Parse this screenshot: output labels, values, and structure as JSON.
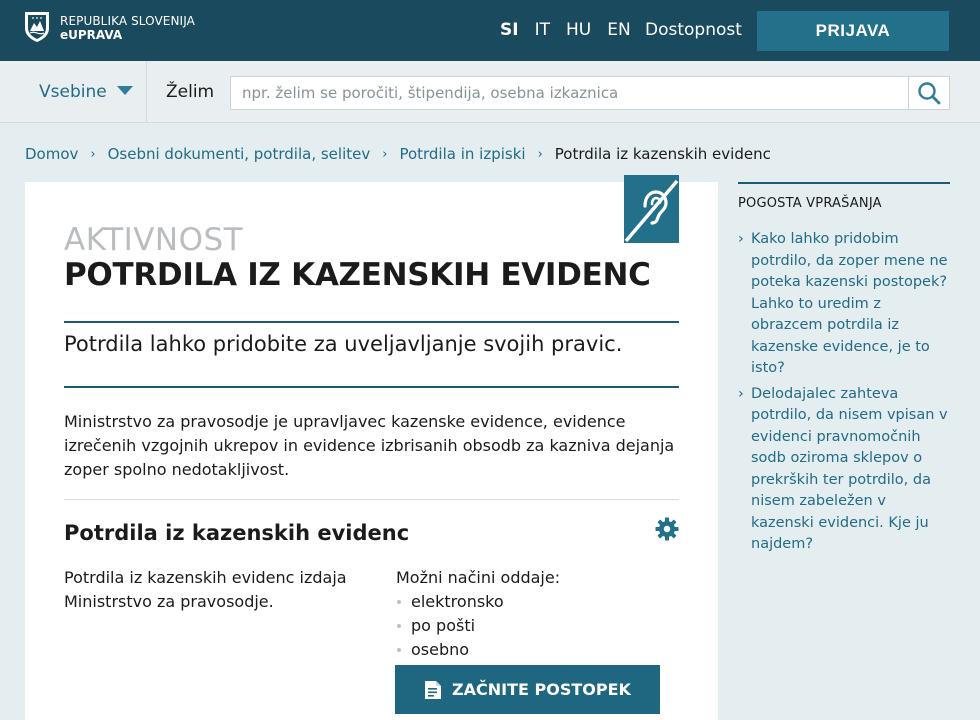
{
  "header": {
    "brand_line1": "REPUBLIKA SLOVENIJA",
    "brand_line2": "eUPRAVA",
    "languages": [
      {
        "code": "SI",
        "active": true
      },
      {
        "code": "IT",
        "active": false
      },
      {
        "code": "HU",
        "active": false
      },
      {
        "code": "EN",
        "active": false
      }
    ],
    "accessibility_link": "Dostopnost",
    "login_label": "PRIJAVA"
  },
  "search": {
    "menu_label": "Vsebine",
    "prefix_label": "Želim",
    "placeholder": "npr. želim se poročiti, štipendija, osebna izkaznica",
    "value": ""
  },
  "breadcrumb": {
    "items": [
      "Domov",
      "Osebni dokumenti, potrdila, selitev",
      "Potrdila in izpiski"
    ],
    "current": "Potrdila iz kazenskih evidenc",
    "separator": "›"
  },
  "main": {
    "eyebrow": "AKTIVNOST",
    "title": "POTRDILA IZ KAZENSKIH EVIDENC",
    "lead": "Potrdila lahko pridobite za uveljavljanje svojih pravic.",
    "description": "Ministrstvo za pravosodje je upravljavec kazenske evidence, evidence izrečenih vzgojnih ukrepov in evidence izbrisanih obsodb za kazniva dejanja zoper spolno nedotakljivost.",
    "section": {
      "title": "Potrdila iz kazenskih evidenc",
      "issuer": "Potrdila iz kazenskih evidenc izdaja Ministrstvo za pravosodje.",
      "methods_label": "Možni načini oddaje:",
      "methods": [
        "elektronsko",
        "po pošti",
        "osebno"
      ],
      "start_label": "ZAČNITE POSTOPEK"
    }
  },
  "faq": {
    "title": "POGOSTA VPRAŠANJA",
    "items": [
      "Kako lahko pridobim potrdilo, da zoper mene ne poteka kazenski postopek? Lahko to uredim z obrazcem potrdila iz kazenske evidence, je to isto?",
      "Delodajalec zahteva potrdilo, da nisem vpisan v evidenci pravnomočnih sodb oziroma sklepov o prekrških ter potrdilo, da nisem zabeležen v kazenski evidenci. Kje ju najdem?"
    ]
  },
  "colors": {
    "header_bg": "#1a4a5e",
    "accent": "#23708a",
    "link": "#236b86",
    "page_bg": "#e4edf0"
  },
  "icons": [
    "coat-of-arms-icon",
    "caret-down-icon",
    "search-icon",
    "hearing-impaired-icon",
    "gear-icon",
    "document-icon",
    "chevron-right-icon"
  ]
}
